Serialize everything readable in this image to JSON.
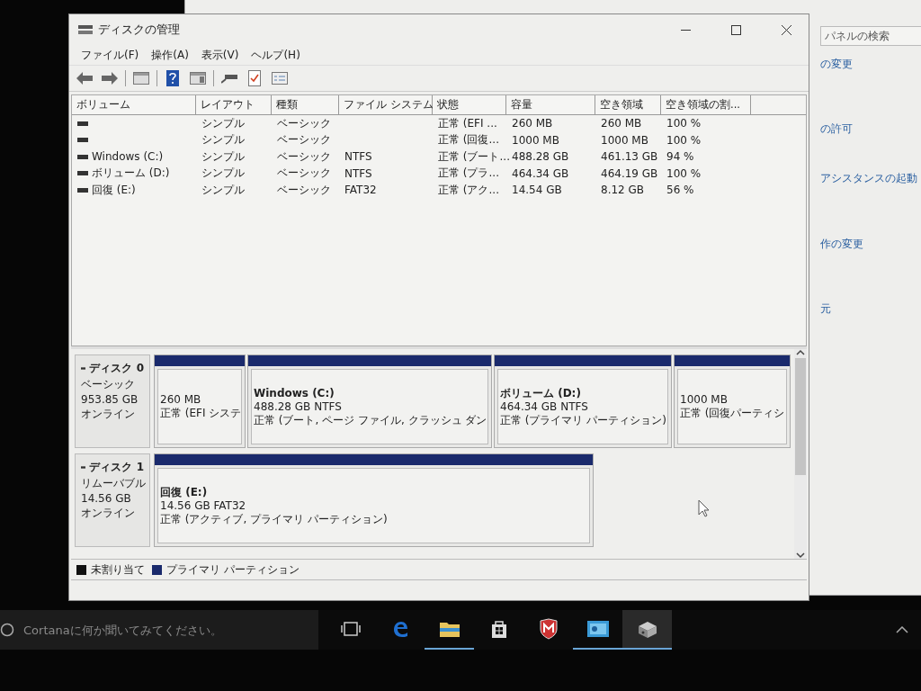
{
  "background_window": {
    "search": {
      "placeholder": "パネルの検索"
    },
    "links": [
      "の変更",
      "の許可",
      "アシスタンスの起動",
      "作の変更",
      "元"
    ]
  },
  "window": {
    "title": "ディスクの管理"
  },
  "menu": [
    "ファイル(F)",
    "操作(A)",
    "表示(V)",
    "ヘルプ(H)"
  ],
  "volumes": {
    "columns": [
      "ボリューム",
      "レイアウト",
      "種類",
      "ファイル システム",
      "状態",
      "容量",
      "空き領域",
      "空き領域の割..."
    ],
    "rows": [
      {
        "cells": [
          "",
          "シンプル",
          "ベーシック",
          "",
          "正常 (EFI ...",
          "260 MB",
          "260 MB",
          "100 %"
        ]
      },
      {
        "cells": [
          "",
          "シンプル",
          "ベーシック",
          "",
          "正常 (回復...",
          "1000 MB",
          "1000 MB",
          "100 %"
        ]
      },
      {
        "cells": [
          "Windows (C:)",
          "シンプル",
          "ベーシック",
          "NTFS",
          "正常 (ブート...",
          "488.28 GB",
          "461.13 GB",
          "94 %"
        ]
      },
      {
        "cells": [
          "ボリューム (D:)",
          "シンプル",
          "ベーシック",
          "NTFS",
          "正常 (プラ...",
          "464.34 GB",
          "464.19 GB",
          "100 %"
        ]
      },
      {
        "cells": [
          "回復 (E:)",
          "シンプル",
          "ベーシック",
          "FAT32",
          "正常 (アク...",
          "14.54 GB",
          "8.12 GB",
          "56 %"
        ]
      }
    ]
  },
  "disks": [
    {
      "name": "ディスク 0",
      "type": "ベーシック",
      "size": "953.85 GB",
      "status": "オンライン",
      "partitions": [
        {
          "size_fs": "260 MB",
          "status": "正常 (EFI システ"
        },
        {
          "label": "Windows (C:)",
          "size_fs": "488.28 GB NTFS",
          "status": "正常 (ブート, ページ ファイル, クラッシュ ダン"
        },
        {
          "label": "ボリューム (D:)",
          "size_fs": "464.34 GB NTFS",
          "status": "正常 (プライマリ パーティション)"
        },
        {
          "size_fs": "1000 MB",
          "status": "正常 (回復パーティシ"
        }
      ]
    },
    {
      "name": "ディスク 1",
      "type": "リムーバブル",
      "size": "14.56 GB",
      "status": "オンライン",
      "partitions": [
        {
          "label": "回復 (E:)",
          "size_fs": "14.56 GB FAT32",
          "status": "正常 (アクティブ, プライマリ パーティション)"
        }
      ]
    }
  ],
  "legend": [
    {
      "label": "未割り当て",
      "color": "#111111"
    },
    {
      "label": "プライマリ パーティション",
      "color": "#1a2a6c"
    }
  ],
  "taskbar": {
    "search": {
      "placeholder": "Cortanaに何か聞いてみてください。"
    },
    "apps": [
      {
        "kind": "taskview",
        "running": false,
        "selected": false
      },
      {
        "kind": "edge",
        "running": false,
        "selected": false
      },
      {
        "kind": "explorer",
        "running": true,
        "selected": false
      },
      {
        "kind": "store",
        "running": false,
        "selected": false
      },
      {
        "kind": "shield",
        "running": false,
        "selected": false
      },
      {
        "kind": "panel",
        "running": true,
        "selected": false
      },
      {
        "kind": "disk",
        "running": true,
        "selected": true
      }
    ]
  }
}
